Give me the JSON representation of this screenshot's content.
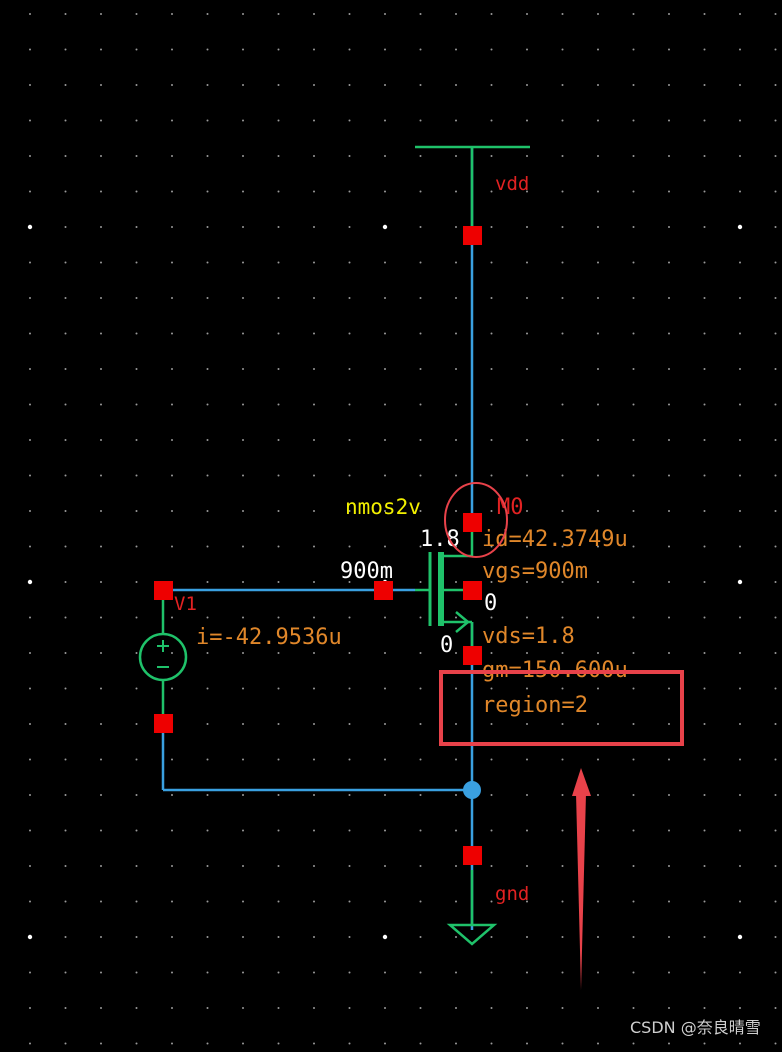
{
  "schematic": {
    "supply_net": "vdd",
    "ground_net": "gnd",
    "transistor": {
      "model": "nmos2v",
      "instance": "M0",
      "drain_voltage": "1.8",
      "gate_voltage": "900m",
      "source_voltage": "0",
      "bulk_voltage": "0",
      "op_params": {
        "id": "id=42.3749u",
        "vgs": "vgs=900m",
        "vds": "vds=1.8",
        "gm": "gm=150.600u",
        "region": "region=2"
      }
    },
    "source": {
      "instance": "V1",
      "current": "i=-42.9536u"
    }
  },
  "colors": {
    "background": "#000000",
    "wire": "#3aa0e0",
    "symbol": "#1fc26a",
    "pin": "#ee0000",
    "annotation": "#e0872a",
    "highlight": "#e8424a"
  },
  "watermark": "CSDN @奈良晴雪"
}
